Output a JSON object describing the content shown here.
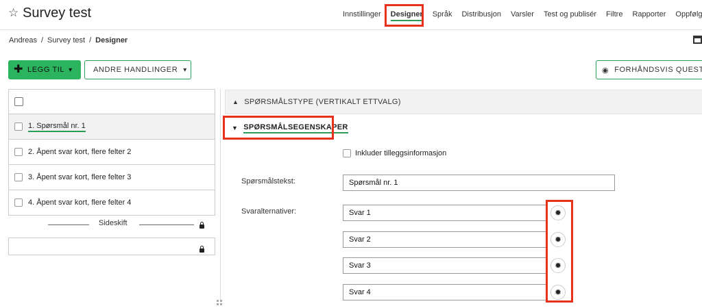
{
  "header": {
    "star_icon": "star-outline-icon",
    "title": "Survey test",
    "nav": [
      {
        "label": "Innstillinger",
        "active": false
      },
      {
        "label": "Designer",
        "active": true
      },
      {
        "label": "Språk",
        "active": false
      },
      {
        "label": "Distribusjon",
        "active": false
      },
      {
        "label": "Varsler",
        "active": false
      },
      {
        "label": "Test og publisér",
        "active": false
      },
      {
        "label": "Filtre",
        "active": false
      },
      {
        "label": "Rapporter",
        "active": false
      },
      {
        "label": "Oppfølging",
        "active": false
      }
    ]
  },
  "breadcrumb": {
    "items": [
      "Andreas",
      "Survey test",
      "Designer"
    ],
    "separator": "/"
  },
  "toolbar": {
    "add_label": "LEGG TIL",
    "other_label": "ANDRE HANDLINGER",
    "preview_label": "FORHÅNDSVIS QUEST",
    "chevron": "▾",
    "plus": "✚",
    "eye": "◉",
    "calendar_icon": "calendar-icon"
  },
  "question_list": {
    "items": [
      {
        "label": "1.  Spørsmål nr. 1",
        "selected": true
      },
      {
        "label": "2.  Åpent svar kort, flere felter 2",
        "selected": false
      },
      {
        "label": "3.  Åpent svar kort, flere felter 3",
        "selected": false
      },
      {
        "label": "4.  Åpent svar kort, flere felter 4",
        "selected": false
      }
    ],
    "page_break_label": "Sideskift"
  },
  "sections": {
    "type_label": "SPØRSMÅLSTYPE (VERTIKALT ETTVALG)",
    "type_arrow": "▲",
    "props_label": "SPØRSMÅLSEGENSKAPER",
    "props_arrow": "▼"
  },
  "properties": {
    "include_extra_label": "Inkluder tilleggsinformasjon",
    "question_text_label": "Spørsmålstekst:",
    "question_text_value": "Spørsmål nr. 1",
    "answers_label": "Svaralternativer:",
    "answers": [
      "Svar 1",
      "Svar 2",
      "Svar 3",
      "Svar 4"
    ],
    "gear_glyph": "✹"
  },
  "colors": {
    "accent_green": "#2bb35e",
    "highlight_red": "#e8301c"
  }
}
